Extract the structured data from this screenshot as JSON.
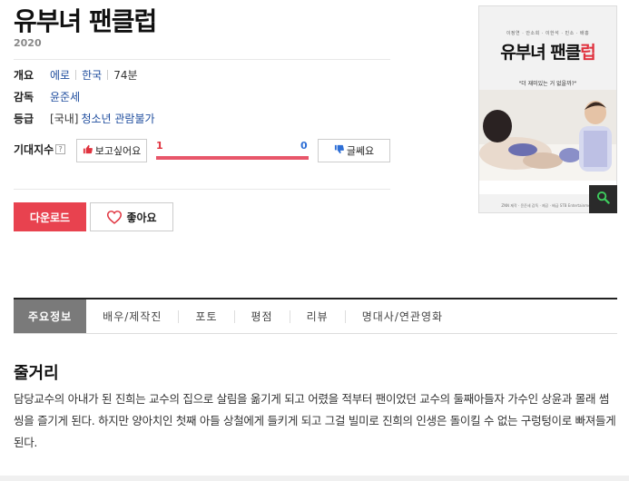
{
  "movie": {
    "title": "유부녀 팬클럽",
    "year": "2020"
  },
  "info": {
    "overview_label": "개요",
    "genre": "에로",
    "country": "한국",
    "runtime": "74분",
    "director_label": "감독",
    "director": "윤준세",
    "rating_label": "등급",
    "rating_region": "[국내]",
    "rating_value": "청소년 관람불가"
  },
  "expectation": {
    "label": "기대지수",
    "help_icon": "?",
    "want_label": "보고싶어요",
    "want_count": "1",
    "not_label": "글쎄요",
    "not_count": "0",
    "want_ratio": 1.0
  },
  "actions": {
    "download_label": "다운로드",
    "like_label": "좋아요"
  },
  "poster": {
    "credits": "이정연 · 안소희 · 이한석 · 민소 · 배홍",
    "title_part1": "유부녀 팬클",
    "title_part2": "럽",
    "tagline": "\"더 재미있는 거 없을까?\"",
    "bottom_text": "ZNN 제작 · 윤준세 감독 · 제공 · 배급 STB Entertainment"
  },
  "tabs": [
    {
      "label": "주요정보",
      "active": true
    },
    {
      "label": "배우/제작진",
      "active": false
    },
    {
      "label": "포토",
      "active": false
    },
    {
      "label": "평점",
      "active": false
    },
    {
      "label": "리뷰",
      "active": false
    },
    {
      "label": "명대사/연관영화",
      "active": false
    }
  ],
  "synopsis": {
    "heading": "줄거리",
    "text": "담당교수의 아내가 된 진희는 교수의 집으로 살림을 옮기게 되고 어렸을 적부터 팬이었던 교수의 둘째아들자 가수인 상윤과 몰래 썸씽을 즐기게 된다. 하지만 양아치인 첫째 아들 상철에게 들키게 되고 그걸 빌미로 진희의 인생은 돌이킬 수 없는 구렁텅이로 빠져들게 된다."
  },
  "colors": {
    "accent": "#e8424f",
    "link": "#1f4d9e",
    "tab_active": "#7a7a7a"
  },
  "icons": {
    "thumb_up": "thumbs-up-icon",
    "thumb_down": "thumbs-down-icon",
    "heart": "heart-icon",
    "zoom": "magnifier-icon"
  }
}
